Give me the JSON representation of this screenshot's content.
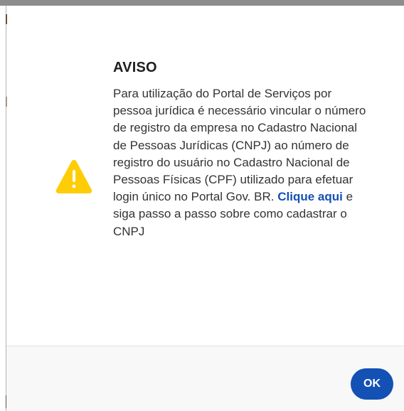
{
  "colors": {
    "accent": "#1351b4",
    "warning": "#ffcd07",
    "title_text": "#1f1f1f",
    "body_text": "#333333",
    "footer_bg": "#f8f8f8"
  },
  "dialog": {
    "icon": "warning-triangle-icon",
    "title": "AVISO",
    "message_before_link": "Para utilização do Portal de Serviços por pessoa jurídica é necessário vincular o número de registro da empresa no Cadastro Nacional de Pessoas Jurídicas (CNPJ) ao número de registro do usuário no Cadastro Nacional de Pessoas Físicas (CPF) utilizado para efetuar login único no Portal Gov. BR.",
    "link_text": "Clique aqui",
    "message_after_link": "e siga passo a passo sobre como cadastrar o CNPJ",
    "ok_label": "OK"
  }
}
